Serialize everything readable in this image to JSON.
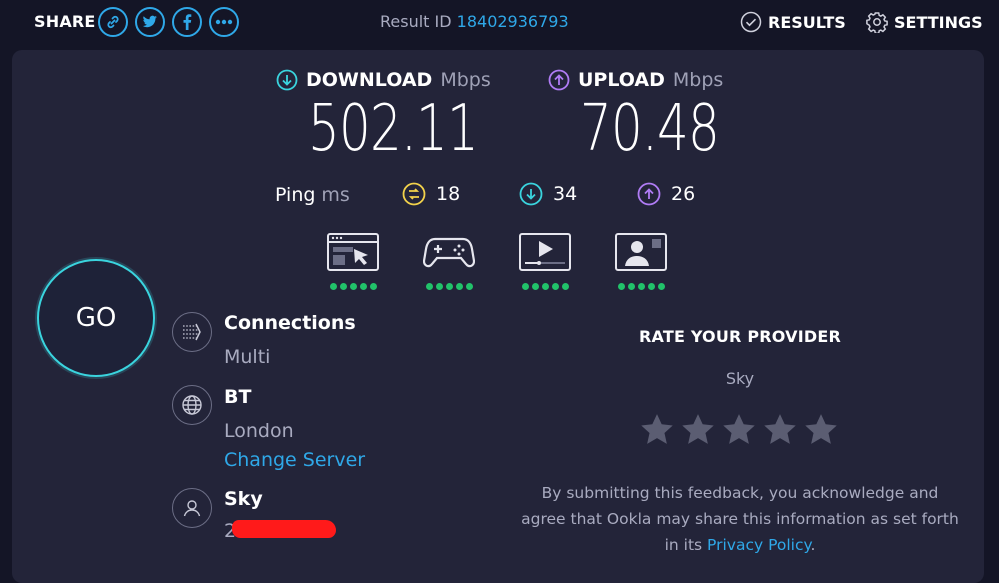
{
  "header": {
    "share_label": "SHARE",
    "share_icons": [
      "link-icon",
      "twitter-icon",
      "facebook-icon",
      "more-icon"
    ],
    "result_id_label": "Result ID",
    "result_id_value": "18402936793",
    "results_label": "RESULTS",
    "settings_label": "SETTINGS"
  },
  "download": {
    "label": "DOWNLOAD",
    "unit": "Mbps",
    "value": "502.11",
    "color": "#3ad4de"
  },
  "upload": {
    "label": "UPLOAD",
    "unit": "Mbps",
    "value": "70.48",
    "color": "#b07cf5"
  },
  "ping": {
    "label": "Ping",
    "unit": "ms",
    "idle": "18",
    "download": "34",
    "upload": "26",
    "idle_color": "#f2d24b"
  },
  "use_cases": [
    {
      "icon": "web-browsing-icon",
      "rating": 5
    },
    {
      "icon": "gaming-icon",
      "rating": 5
    },
    {
      "icon": "video-streaming-icon",
      "rating": 5
    },
    {
      "icon": "video-chat-icon",
      "rating": 5
    }
  ],
  "go_label": "GO",
  "connections": {
    "title": "Connections",
    "value": "Multi"
  },
  "server": {
    "name": "BT",
    "location": "London",
    "change_label": "Change Server"
  },
  "provider": {
    "name": "Sky",
    "ip_visible_prefix": "2"
  },
  "rating": {
    "title": "RATE YOUR PROVIDER",
    "isp": "Sky",
    "stars": 5,
    "disclaimer_prefix": "By submitting this feedback, you acknowledge and agree that Ookla may share this information as set forth in its",
    "privacy_link": "Privacy Policy",
    "disclaimer_suffix": "."
  },
  "colors": {
    "background": "#141526",
    "panel": "#232439",
    "accent": "#2fa8e8",
    "good": "#21c36a"
  }
}
